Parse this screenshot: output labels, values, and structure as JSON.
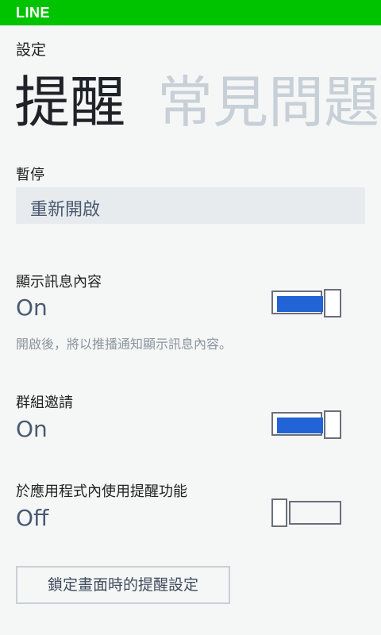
{
  "app": {
    "brand": "LINE"
  },
  "header": {
    "section_title": "設定"
  },
  "pivot": {
    "active": "提醒",
    "inactive": "常見問題"
  },
  "pause": {
    "label": "暫停",
    "value": "重新開啟"
  },
  "show_message": {
    "label": "顯示訊息內容",
    "state": "On",
    "description": "開啟後，將以推播通知顯示訊息內容。",
    "enabled": true
  },
  "group_invite": {
    "label": "群組邀請",
    "state": "On",
    "enabled": true
  },
  "in_app": {
    "label": "於應用程式內使用提醒功能",
    "state": "Off",
    "enabled": false
  },
  "lock_screen_button": {
    "label": "鎖定畫面時的提醒設定"
  },
  "colors": {
    "brand_green": "#00c300",
    "toggle_on": "#2263d6"
  }
}
